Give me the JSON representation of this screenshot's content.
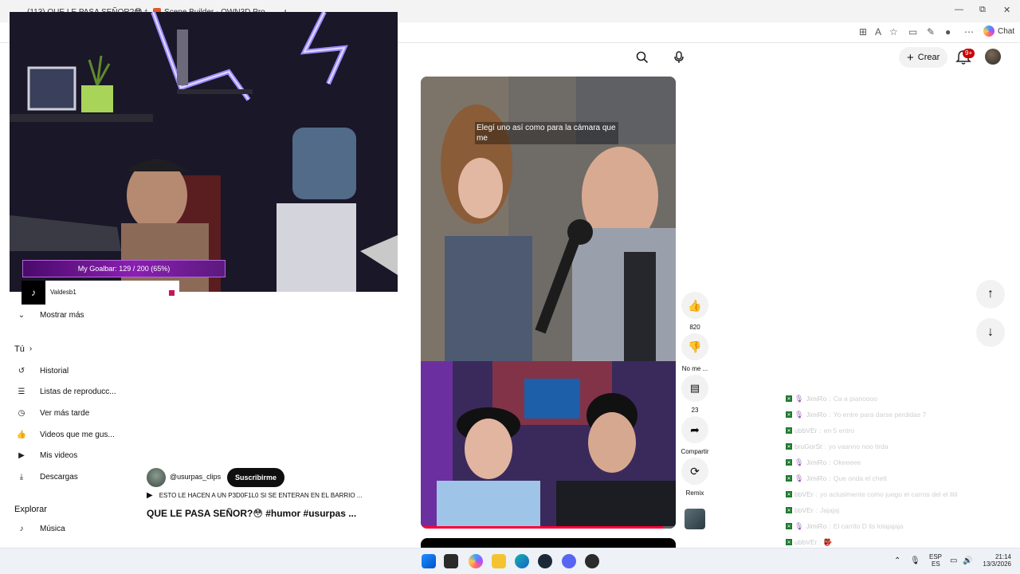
{
  "browser": {
    "tabs": [
      {
        "title": "(113) QUE LE PASA SEÑOR?😳 #",
        "color": "#ff0033"
      },
      {
        "title": "Scene Builder - OWN3D Pro",
        "color": "#e05a2b"
      }
    ],
    "new_tab": "+",
    "window": {
      "minimize": "—",
      "maximize": "⧉",
      "close": "✕"
    },
    "chat_label": "Chat"
  },
  "header": {
    "create_label": "Crear",
    "notifications_badge": "9+"
  },
  "stream": {
    "goal_text": "My Goalbar: 129 / 200 (65%)",
    "tiktok_user": "Valdesb1"
  },
  "sidebar": {
    "more": "Mostrar más",
    "you_heading": "Tú",
    "you_items": [
      {
        "label": "Historial",
        "icon": "history-icon"
      },
      {
        "label": "Listas de reproducc...",
        "icon": "playlists-icon"
      },
      {
        "label": "Ver más tarde",
        "icon": "watch-later-icon"
      },
      {
        "label": "Videos que me gus...",
        "icon": "liked-icon"
      },
      {
        "label": "Mis videos",
        "icon": "my-videos-icon"
      },
      {
        "label": "Descargas",
        "icon": "downloads-icon"
      }
    ],
    "explore_heading": "Explorar",
    "explore_items": [
      {
        "label": "Música",
        "icon": "music-icon"
      }
    ]
  },
  "short": {
    "caption": "Elegí uno así como para la cámara que me",
    "progress": 0.95,
    "channel": "@usurpas_clips",
    "subscribe": "Suscribirme",
    "song": "ESTO LE HACEN A UN P3D0F1L0 SI SE ENTERAN EN EL BARRIO ...",
    "title": "QUE LE PASA SEÑOR?😳 #humor #usurpas ..."
  },
  "actions": {
    "likes": "820",
    "dislike": "No me ...",
    "comments": "23",
    "share": "Compartir",
    "remix": "Remix"
  },
  "chat": [
    {
      "name": "JimiRo",
      "msg": "Ca a pianoooo",
      "mic": true
    },
    {
      "name": "JimiRo",
      "msg": "Yo entre para darse perdidas 7",
      "mic": true
    },
    {
      "name": "ubbVEr",
      "msg": "en 5 entro",
      "mic": false
    },
    {
      "name": "bruGorSt",
      "msg": "yo vaanno noo tirda",
      "mic": false
    },
    {
      "name": "JimiRo",
      "msg": "Okeeeee",
      "mic": true
    },
    {
      "name": "JimiRo",
      "msg": "Que onda el chett",
      "mic": true
    },
    {
      "name": "bbVEr",
      "msg": "yo acluslmente como juego el carros del el lliil",
      "mic": false
    },
    {
      "name": "bbVEr",
      "msg": "Jajajaj",
      "mic": false
    },
    {
      "name": "JimiRo",
      "msg": "El carrito D lis lolajajaja",
      "mic": true
    },
    {
      "name": "ubbVEr",
      "msg": "👺",
      "mic": false
    },
    {
      "name": "JORBV",
      "msg": "👺",
      "mic": true
    }
  ],
  "taskbar": {
    "lang": "ESP",
    "lang2": "ES",
    "time": "21:14",
    "date": "13/3/2026"
  }
}
